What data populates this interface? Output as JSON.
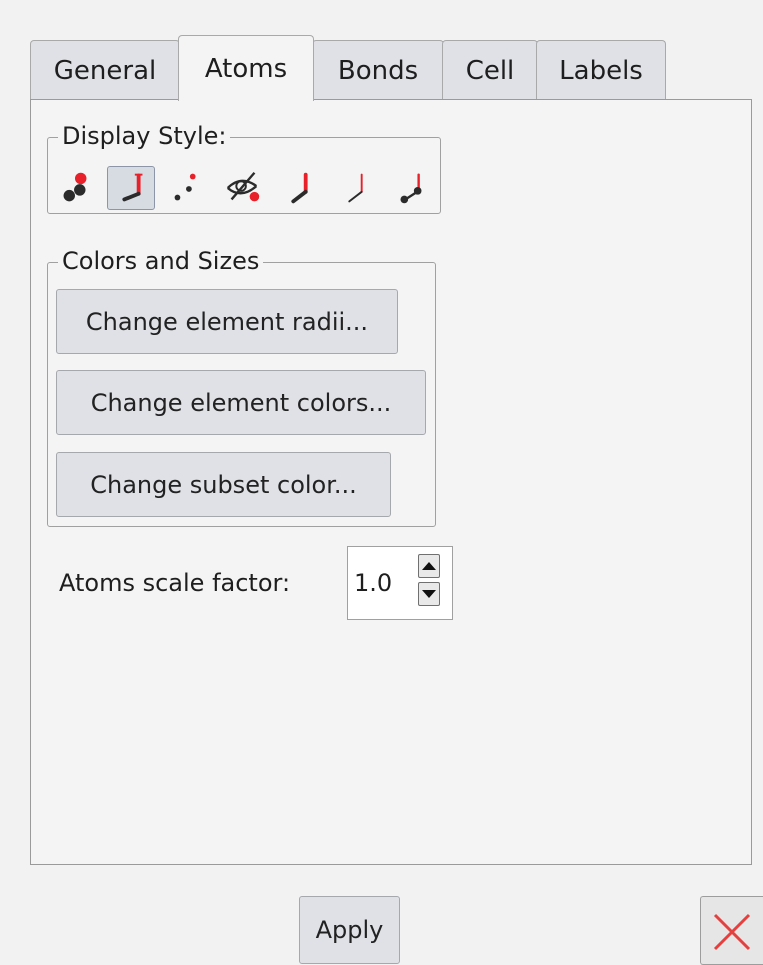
{
  "tabs": [
    {
      "label": "General",
      "active": false
    },
    {
      "label": "Atoms",
      "active": true
    },
    {
      "label": "Bonds",
      "active": false
    },
    {
      "label": "Cell",
      "active": false
    },
    {
      "label": "Labels",
      "active": false
    }
  ],
  "display_style": {
    "legend": "Display Style:",
    "options": [
      {
        "icon": "ball-and-stick-icon",
        "selected": false
      },
      {
        "icon": "stick-icon",
        "selected": true
      },
      {
        "icon": "dots-icon",
        "selected": false
      },
      {
        "icon": "hidden-icon",
        "selected": false
      },
      {
        "icon": "thick-line-icon",
        "selected": false
      },
      {
        "icon": "thin-line-icon",
        "selected": false
      },
      {
        "icon": "line-and-ball-icon",
        "selected": false
      }
    ]
  },
  "colors_sizes": {
    "legend": "Colors and Sizes",
    "change_radii": "Change element radii...",
    "change_colors": "Change element colors...",
    "change_subset": "Change subset color..."
  },
  "scale": {
    "label": "Atoms scale factor:",
    "value": "1.0"
  },
  "footer": {
    "apply": "Apply",
    "close_icon": "close-icon"
  },
  "colors": {
    "atom_red": "#e8202a",
    "atom_dark": "#2b2b2b",
    "close_red": "#e54040"
  }
}
